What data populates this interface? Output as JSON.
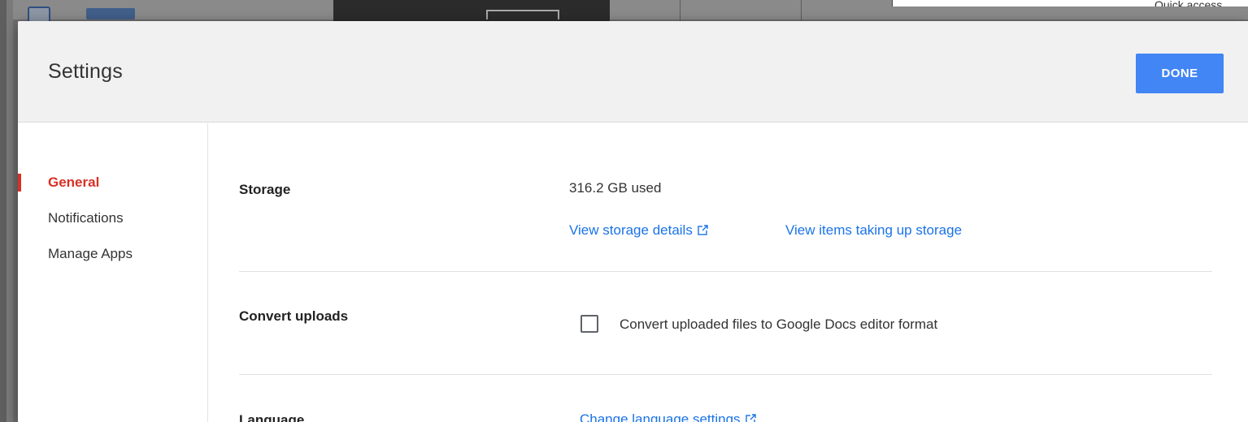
{
  "background": {
    "quick_access_label": "Quick access"
  },
  "dialog": {
    "title": "Settings",
    "done_label": "DONE"
  },
  "nav": {
    "items": [
      {
        "label": "General",
        "active": true
      },
      {
        "label": "Notifications",
        "active": false
      },
      {
        "label": "Manage Apps",
        "active": false
      }
    ]
  },
  "storage": {
    "label": "Storage",
    "used": "316.2 GB used",
    "details_link": "View storage details",
    "items_link": "View items taking up storage"
  },
  "convert": {
    "label": "Convert uploads",
    "checkbox_label": "Convert uploaded files to Google Docs editor format",
    "checked": false
  },
  "language": {
    "label": "Language",
    "link": "Change language settings"
  },
  "colors": {
    "accent_blue": "#4285f4",
    "link_blue": "#1a73e8",
    "active_red": "#d93025"
  },
  "icons": {
    "external_link": "open-in-new-icon"
  }
}
